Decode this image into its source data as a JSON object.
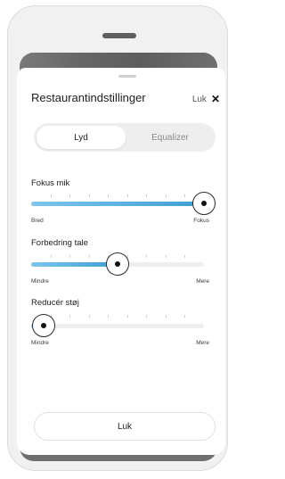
{
  "sheet": {
    "title": "Restaurantindstillinger",
    "close_label": "Luk"
  },
  "tabs": [
    {
      "label": "Lyd",
      "active": true
    },
    {
      "label": "Equalizer",
      "active": false
    }
  ],
  "sliders": [
    {
      "label": "Fokus mik",
      "min_label": "Bred",
      "max_label": "Fokus",
      "value": 1.0
    },
    {
      "label": "Forbedring tale",
      "min_label": "Mindre",
      "max_label": "Mere",
      "value": 0.5
    },
    {
      "label": "Reducér støj",
      "min_label": "Mindre",
      "max_label": "Mere",
      "value": 0.07
    }
  ],
  "footer": {
    "button_label": "Luk"
  },
  "colors": {
    "accent_start": "#7cc6ee",
    "accent_end": "#3f9ed4"
  },
  "icons": {
    "close": "close-icon"
  }
}
